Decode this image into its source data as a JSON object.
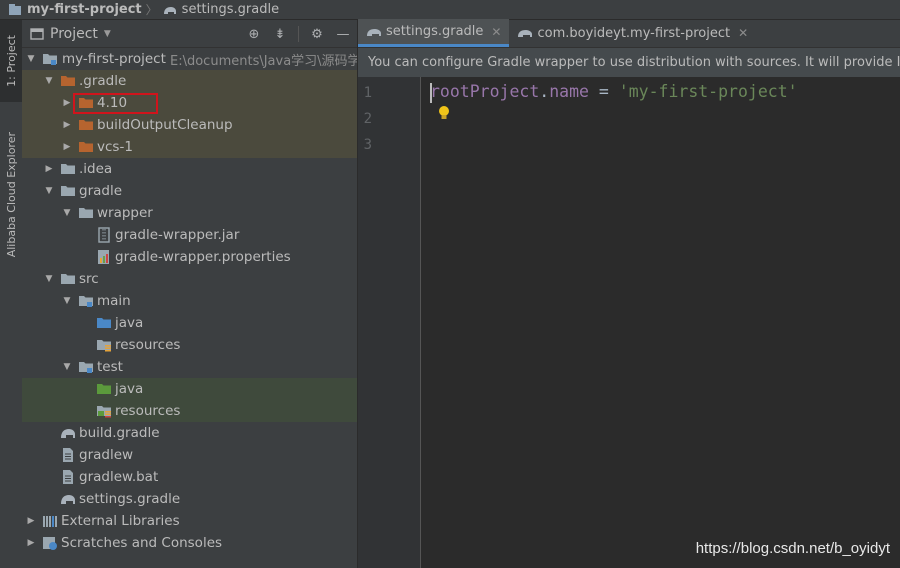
{
  "breadcrumb": {
    "project": "my-first-project",
    "file": "settings.gradle"
  },
  "toolstrip": {
    "project_tab": "1: Project",
    "cloud_tab": "Alibaba Cloud Explorer"
  },
  "panel": {
    "title": "Project"
  },
  "tree": {
    "root_label": "my-first-project",
    "root_path": "E:\\documents\\Java学习\\源码学",
    "items": [
      ".gradle",
      "4.10",
      "buildOutputCleanup",
      "vcs-1",
      ".idea",
      "gradle",
      "wrapper",
      "gradle-wrapper.jar",
      "gradle-wrapper.properties",
      "src",
      "main",
      "java",
      "resources",
      "test",
      "java",
      "resources",
      "build.gradle",
      "gradlew",
      "gradlew.bat",
      "settings.gradle",
      "External Libraries",
      "Scratches and Consoles"
    ]
  },
  "editor": {
    "tabs": [
      {
        "label": "settings.gradle",
        "active": true
      },
      {
        "label": "com.boyideyt.my-first-project",
        "active": false
      }
    ],
    "notice": "You can configure Gradle wrapper to use distribution with sources. It will provide IDE w",
    "line_numbers": [
      "1",
      "2",
      "3"
    ],
    "code_line1": {
      "object": "rootProject",
      "dot": ".",
      "property": "name",
      "op": " = ",
      "string": "'my-first-project'"
    }
  },
  "watermark": "https://blog.csdn.net/b_oyidyt",
  "colors": {
    "accent": "#4a88c7",
    "folder": "#b6642f",
    "highlight_box": "#d0141c",
    "string": "#6a8759",
    "property": "#9876aa"
  }
}
